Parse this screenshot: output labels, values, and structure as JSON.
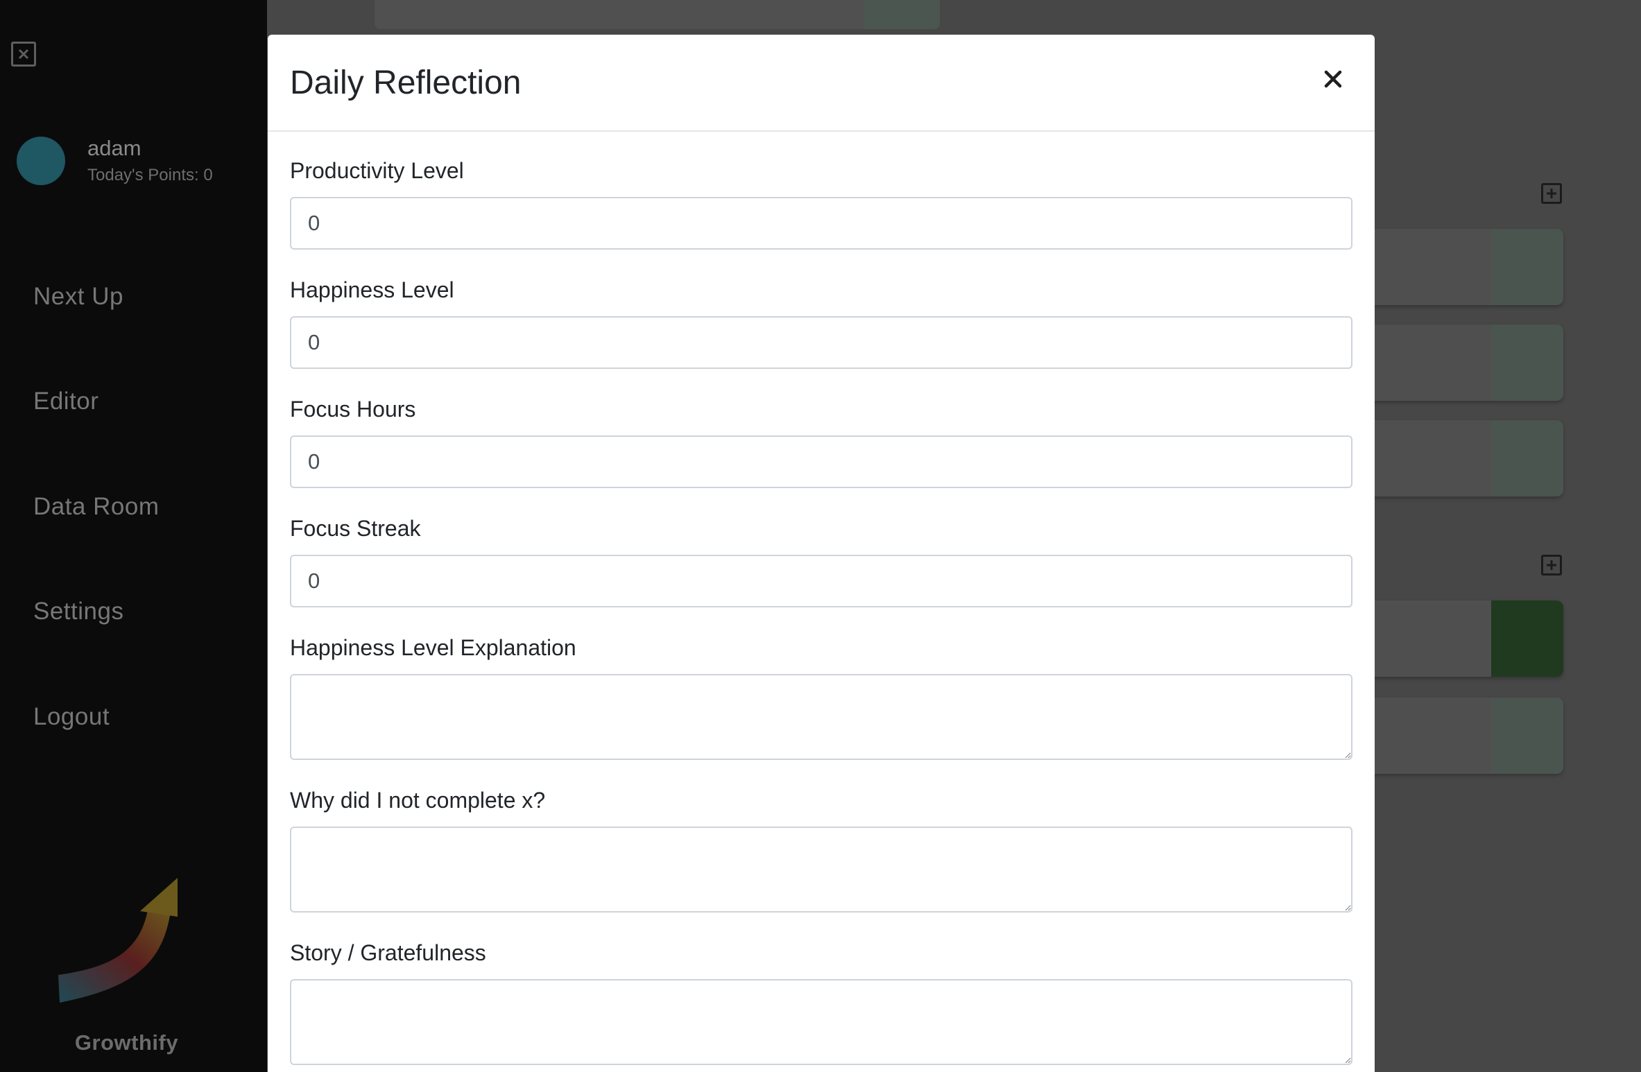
{
  "sidebar": {
    "user": {
      "name": "adam",
      "points_label": "Today's Points: 0"
    },
    "nav": [
      {
        "label": "Next Up"
      },
      {
        "label": "Editor"
      },
      {
        "label": "Data Room"
      },
      {
        "label": "Settings"
      },
      {
        "label": "Logout"
      }
    ],
    "brand": "Growthify"
  },
  "modal": {
    "title": "Daily Reflection",
    "fields": [
      {
        "label": "Productivity Level",
        "value": "0"
      },
      {
        "label": "Happiness Level",
        "value": "0"
      },
      {
        "label": "Focus Hours",
        "value": "0"
      },
      {
        "label": "Focus Streak",
        "value": "0"
      }
    ],
    "textareas": [
      {
        "label": "Happiness Level Explanation",
        "value": ""
      },
      {
        "label": "Why did I not complete x?",
        "value": ""
      },
      {
        "label": "Story / Gratefulness",
        "value": ""
      }
    ]
  },
  "icons": {
    "sidebar_close": "close-square-icon",
    "modal_close": "close-icon",
    "add": "plus-square-icon"
  },
  "colors": {
    "sidebar_bg": "#0b0b0b",
    "overlay_bg": "#474747",
    "avatar": "#1f5762",
    "active_card_accent": "#203a20"
  }
}
